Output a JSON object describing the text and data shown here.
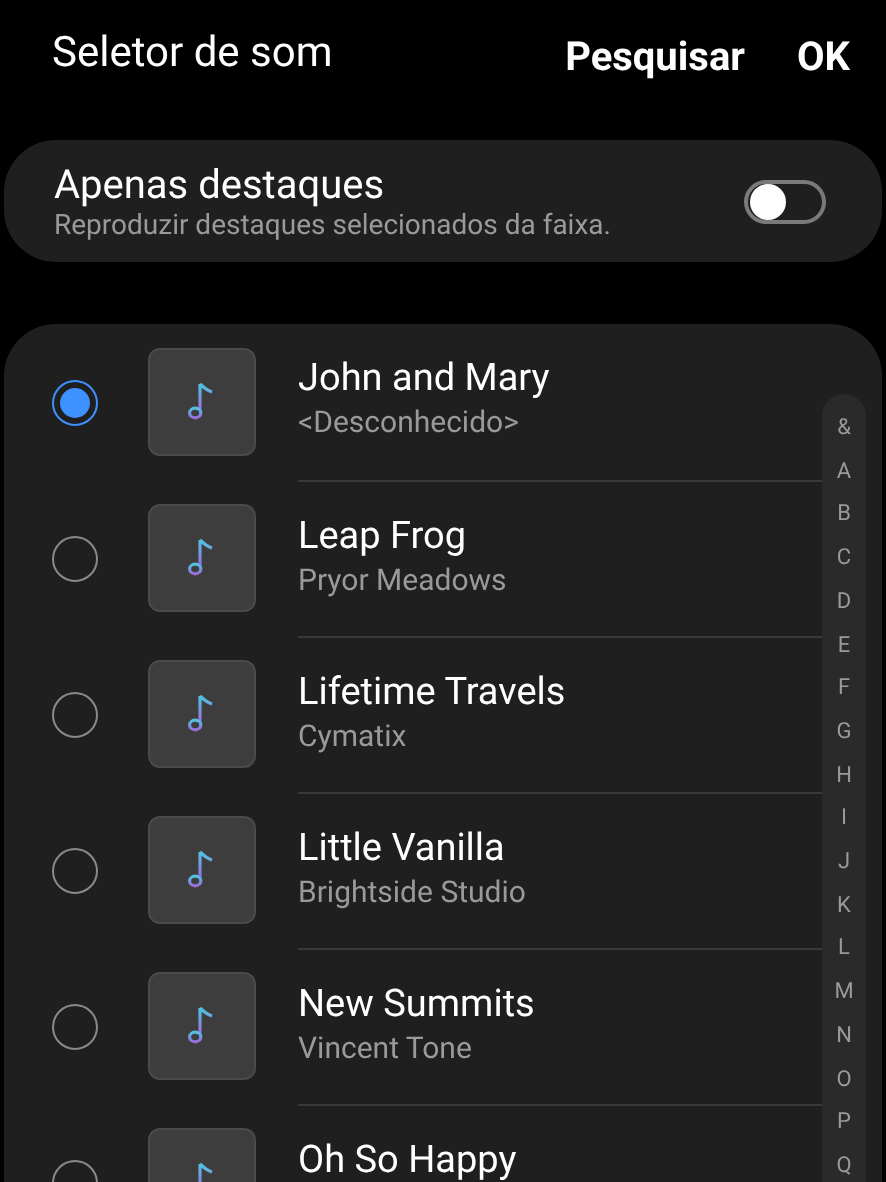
{
  "header": {
    "title": "Seletor de som",
    "actions": [
      "Pesquisar",
      "OK"
    ]
  },
  "highlights": {
    "title": "Apenas destaques",
    "subtitle": "Reproduzir destaques selecionados da faixa.",
    "on": false
  },
  "tracks": [
    {
      "title": "John and Mary",
      "artist": "<Desconhecido>",
      "selected": true
    },
    {
      "title": "Leap Frog",
      "artist": "Pryor Meadows",
      "selected": false
    },
    {
      "title": "Lifetime Travels",
      "artist": "Cymatix",
      "selected": false
    },
    {
      "title": "Little Vanilla",
      "artist": "Brightside Studio",
      "selected": false
    },
    {
      "title": "New Summits",
      "artist": "Vincent Tone",
      "selected": false
    },
    {
      "title": "Oh So Happy",
      "selected": false
    }
  ],
  "index_letters": [
    "&",
    "A",
    "B",
    "C",
    "D",
    "E",
    "F",
    "G",
    "H",
    "I",
    "J",
    "K",
    "L",
    "M",
    "N",
    "O",
    "P",
    "Q"
  ]
}
